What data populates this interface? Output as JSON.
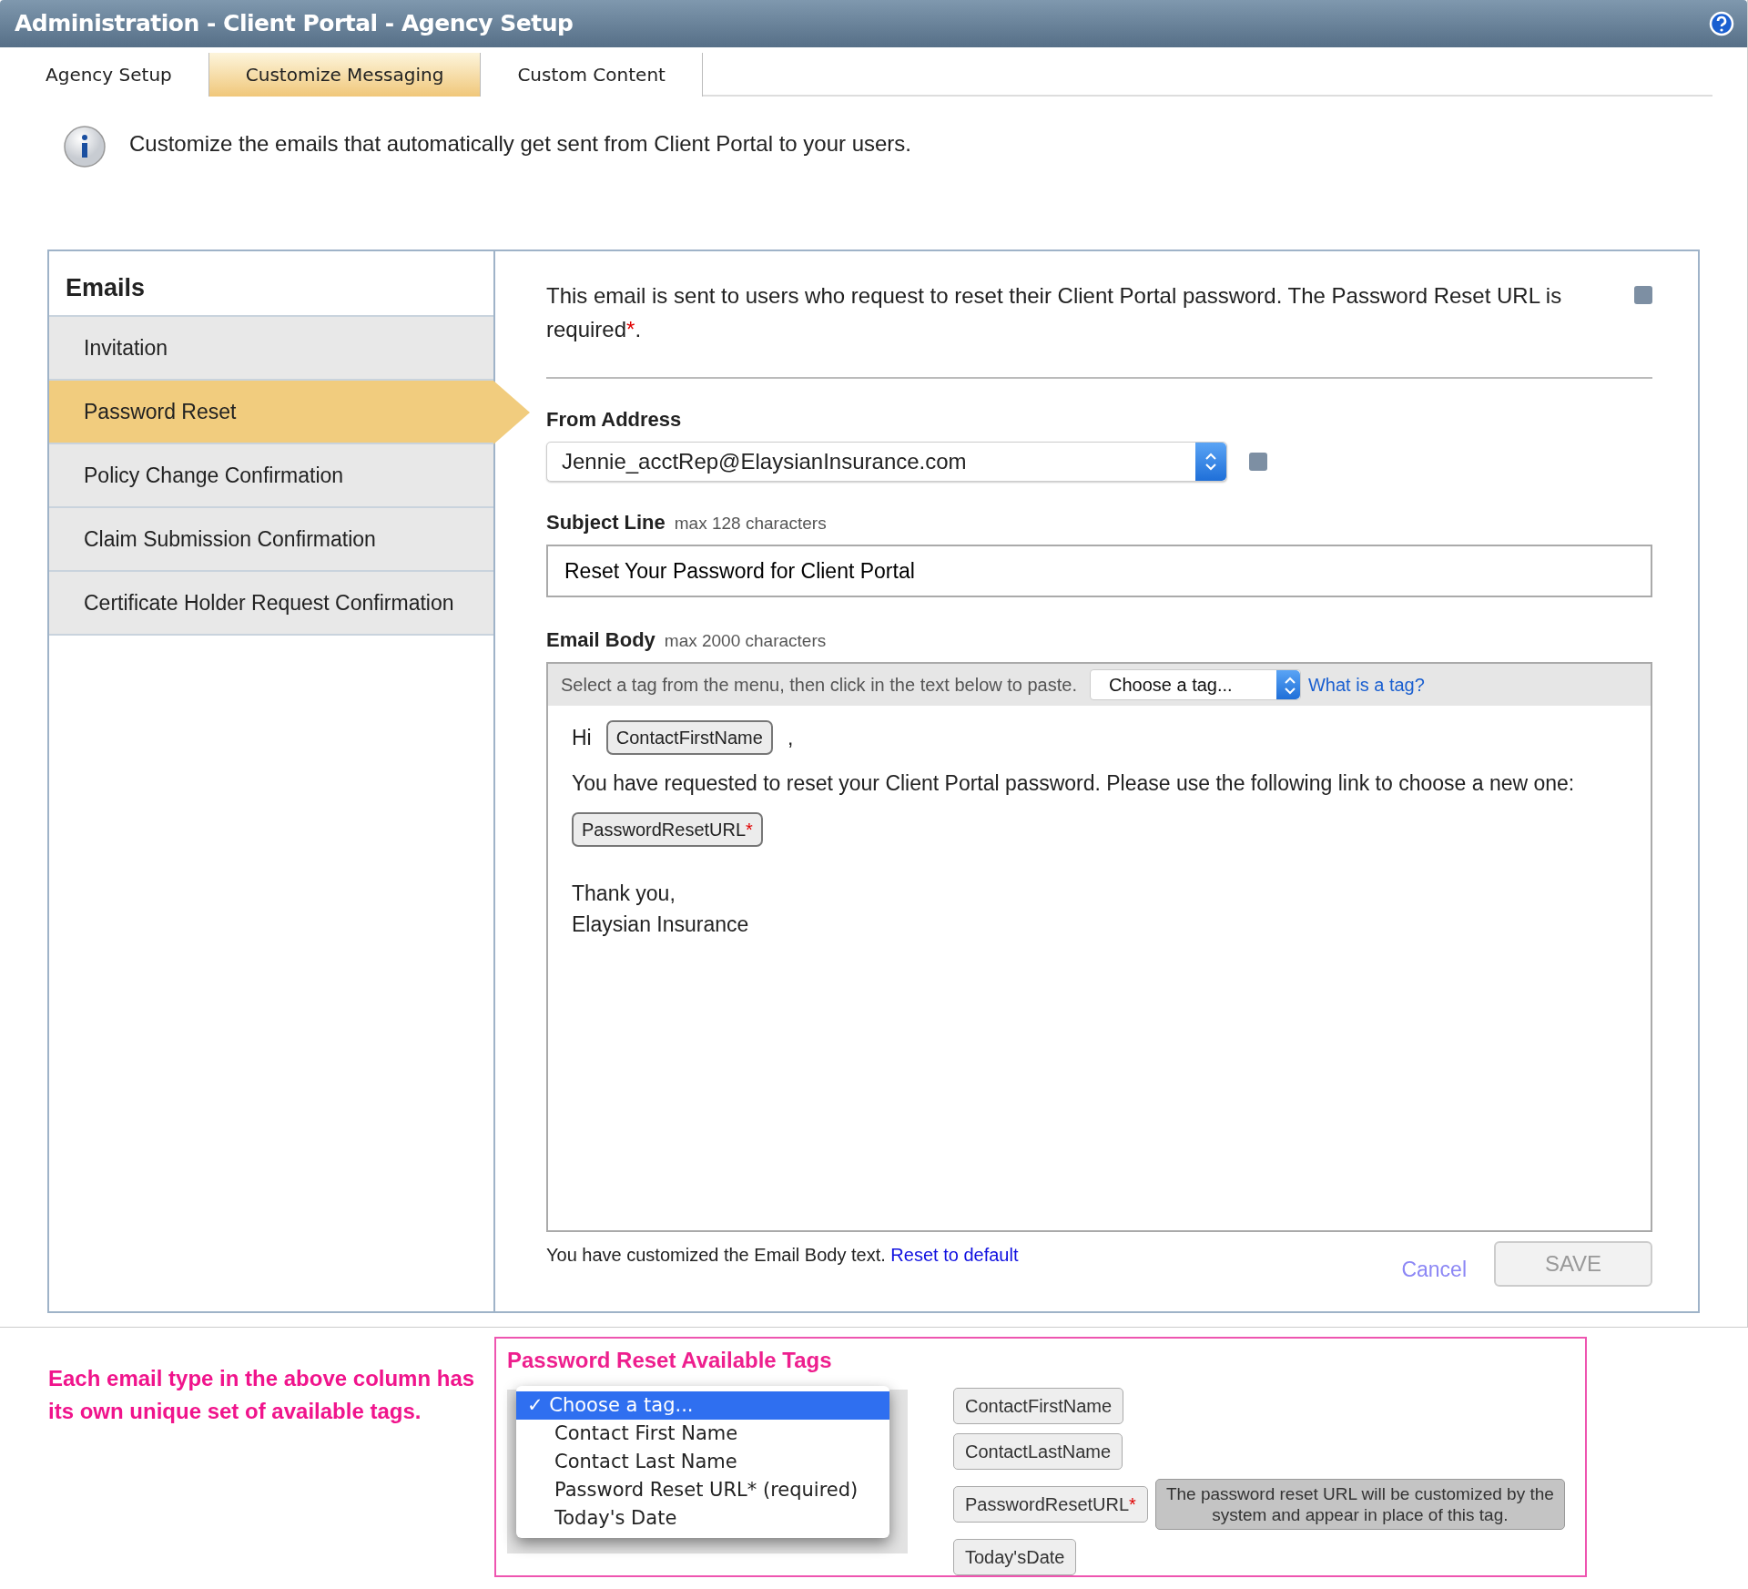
{
  "header": {
    "title": "Administration - Client Portal - Agency Setup"
  },
  "tabs": [
    {
      "label": "Agency Setup",
      "selected": false
    },
    {
      "label": "Customize Messaging",
      "selected": true
    },
    {
      "label": "Custom Content",
      "selected": false
    }
  ],
  "info": {
    "text": "Customize the emails that automatically get sent from Client Portal to your users."
  },
  "emails": {
    "title": "Emails",
    "items": [
      {
        "label": "Invitation",
        "selected": false
      },
      {
        "label": "Password Reset",
        "selected": true
      },
      {
        "label": "Policy Change Confirmation",
        "selected": false
      },
      {
        "label": "Claim Submission Confirmation",
        "selected": false
      },
      {
        "label": "Certificate Holder Request Confirmation",
        "selected": false
      }
    ]
  },
  "editor": {
    "description": "This email is sent to users who request to reset their Client Portal password. The Password Reset URL is required",
    "required_mark": "*",
    "description_end": ".",
    "from_address": {
      "label": "From Address",
      "value": "Jennie_acctRep@ElaysianInsurance.com"
    },
    "subject": {
      "label": "Subject Line",
      "hint": "max 128 characters",
      "value": "Reset Your Password for Client Portal"
    },
    "body": {
      "label": "Email Body",
      "hint": "max 2000 characters",
      "toolbar_text": "Select a tag from the menu, then click in the text below to paste.",
      "tag_select": "Choose a tag...",
      "help_link": "What is a tag?",
      "paragraphs": [
        [
          {
            "kind": "text",
            "text": "Hi"
          },
          {
            "kind": "tag",
            "text": "ContactFirstName"
          },
          {
            "kind": "text",
            "text": ","
          }
        ],
        [
          {
            "kind": "text",
            "text": "You have requested to reset your Client Portal password. Please use the following link to choose a new one:"
          }
        ],
        [
          {
            "kind": "tag",
            "text": "PasswordResetURL",
            "mark": "*"
          }
        ],
        [
          {
            "kind": "text",
            "text": "Thank you,"
          }
        ],
        [
          {
            "kind": "text",
            "text": "Elaysian Insurance"
          }
        ]
      ]
    },
    "status": {
      "text": "You have customized the Email Body text.",
      "link": "Reset to default"
    },
    "buttons": [
      {
        "kind": "link",
        "label": "Cancel",
        "disabled": true
      },
      {
        "kind": "button",
        "label": "SAVE",
        "disabled": true
      }
    ]
  },
  "annotation": {
    "text": "Each email type in the above column has its own unique set of available tags."
  },
  "tags_panel": {
    "title": "Password Reset Available Tags",
    "check_mark": "✓",
    "menu": [
      {
        "label": "Choose a tag...",
        "selected": true
      },
      {
        "label": "Contact First Name",
        "selected": false
      },
      {
        "label": "Contact Last Name",
        "selected": false
      },
      {
        "label": "Password Reset URL* (required)",
        "selected": false
      },
      {
        "label": "Today's Date",
        "selected": false
      }
    ],
    "tags": [
      {
        "text": "ContactFirstName"
      },
      {
        "text": "ContactLastName"
      },
      {
        "text": "PasswordResetURL",
        "mark": "*",
        "note": "The password reset URL will be customized by the system and appear in place of this tag."
      },
      {
        "text": "Today'sDate"
      }
    ]
  }
}
